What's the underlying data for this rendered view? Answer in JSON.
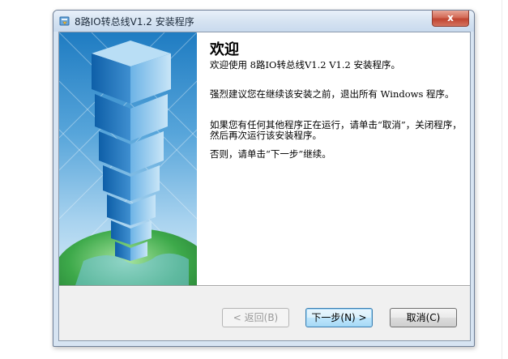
{
  "window": {
    "title": "8路IO转总线V1.2 安装程序",
    "close_glyph": "x"
  },
  "content": {
    "heading": "欢迎",
    "paragraphs": [
      "欢迎使用 8路IO转总线V1.2 V1.2 安装程序。",
      "强烈建议您在继续该安装之前，退出所有 Windows 程序。",
      "如果您有任何其他程序正在运行，请单击“取消”，关闭程序，然后再次运行该安装程序。",
      "否则，请单击“下一步”继续。"
    ]
  },
  "buttons": {
    "back": "< 返回(B)",
    "next": "下一步(N) >",
    "cancel": "取消(C)"
  },
  "icons": {
    "app": "installer-icon",
    "close": "close-icon"
  },
  "colors": {
    "titlebar": "#d4e2f1",
    "close": "#c9503d",
    "banner_top": "#1f7cc2",
    "content_bg": "#ffffff",
    "dialog_bg": "#f0f0f0",
    "default_button": "#3c7fb1"
  },
  "state": {
    "back_disabled": true,
    "default_button": "next"
  }
}
